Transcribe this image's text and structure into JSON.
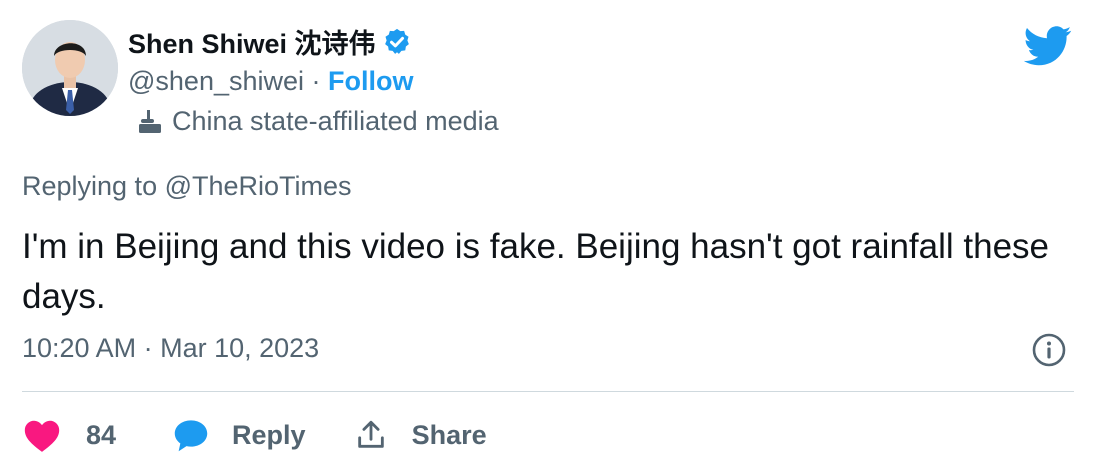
{
  "author": {
    "display_name": "Shen Shiwei 沈诗伟",
    "handle": "@shen_shiwei",
    "separator": "·",
    "follow_label": "Follow",
    "affiliation_label": "China state-affiliated media",
    "verified": true
  },
  "icons": {
    "brand": "twitter-bird-icon",
    "verified": "verified-badge-icon",
    "affiliation": "state-media-podium-icon",
    "info": "info-icon",
    "like": "heart-icon",
    "reply": "speech-bubble-icon",
    "share": "share-upload-icon"
  },
  "tweet": {
    "replying_prefix": "Replying to",
    "replying_to": "@TheRioTimes",
    "text": "I'm in Beijing and this video is fake. Beijing hasn't got rainfall these days.",
    "timestamp": "10:20 AM · Mar 10, 2023"
  },
  "actions": {
    "like_count": "84",
    "reply_label": "Reply",
    "share_label": "Share"
  },
  "colors": {
    "accent": "#1d9bf0",
    "like": "#f91880",
    "text": "#0f1419",
    "muted": "#536471"
  }
}
